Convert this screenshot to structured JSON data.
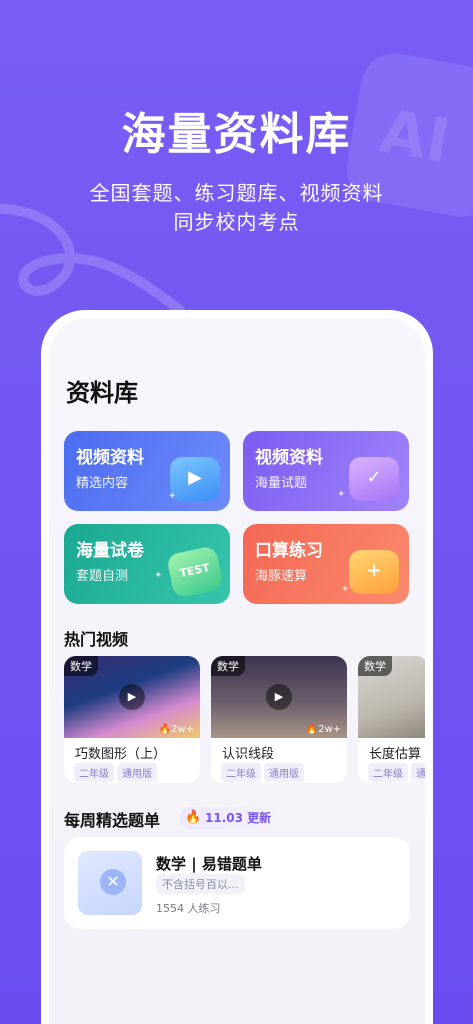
{
  "hero": {
    "title": "海量资料库",
    "subtitle_line1": "全国套题、练习题库、视频资料",
    "subtitle_line2": "同步校内考点",
    "deco_text": "AI"
  },
  "library": {
    "title": "资料库",
    "cards": [
      {
        "title": "视频资料",
        "subtitle": "精选内容",
        "icon": "tv-play-icon"
      },
      {
        "title": "视频资料",
        "subtitle": "海量试题",
        "icon": "checklist-icon"
      },
      {
        "title": "海量试卷",
        "subtitle": "套题自测",
        "icon": "test-paper-icon",
        "icon_text": "TEST"
      },
      {
        "title": "口算练习",
        "subtitle": "海豚速算",
        "icon": "calculator-box-icon"
      }
    ]
  },
  "hot_videos": {
    "title": "热门视频",
    "items": [
      {
        "tag": "数学",
        "name": "巧数图形（上）",
        "views": "2w+",
        "chips": [
          "二年级",
          "通用版"
        ]
      },
      {
        "tag": "数学",
        "name": "认识线段",
        "views": "2w+",
        "chips": [
          "二年级",
          "通用版"
        ]
      },
      {
        "tag": "数学",
        "name": "长度估算",
        "views": "",
        "chips": [
          "二年级",
          "通"
        ]
      }
    ]
  },
  "weekly": {
    "title": "每周精选题单",
    "badge": "11.03 更新",
    "item": {
      "title": "数学 | 易错题单",
      "tag": "不含括号百以...",
      "count": "1554 人练习"
    }
  },
  "colors": {
    "background": "#7457f2",
    "card_blue": "#4b6cf0",
    "card_purple": "#7b5cf2",
    "card_green": "#1aa892",
    "card_red": "#f36754",
    "accent": "#7b55f0"
  }
}
